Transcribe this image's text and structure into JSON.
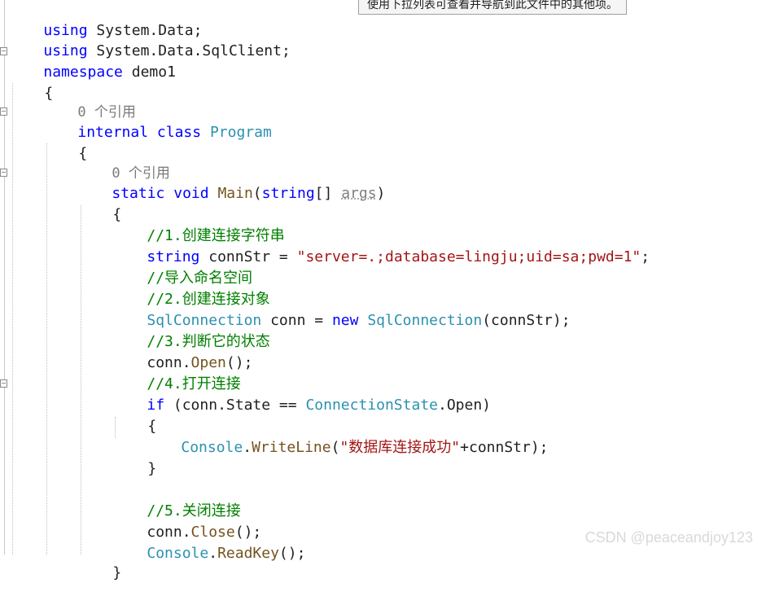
{
  "tooltip": {
    "text": "使用下拉列表可查看并导航到此文件中的其他项。"
  },
  "code": {
    "l1_kw": "using",
    "l1_rest": " System.Data;",
    "l2_kw": "using",
    "l2_rest": " System.Data.SqlClient;",
    "l3_kw": "namespace",
    "l3_rest": " demo1",
    "l4": "{",
    "l5_codelens": "0 个引用",
    "l6_kw1": "internal",
    "l6_kw2": "class",
    "l6_type": "Program",
    "l7": "{",
    "l8_codelens": "0 个引用",
    "l9_kw1": "static",
    "l9_kw2": "void",
    "l9_meth": "Main",
    "l9_open": "(",
    "l9_kw3": "string",
    "l9_brk": "[] ",
    "l9_param": "args",
    "l9_close": ")",
    "l10": "{",
    "l11_cmt": "//1.创建连接字符串",
    "l12_kw": "string",
    "l12_mid": " connStr = ",
    "l12_str": "\"server=.;database=lingju;uid=sa;pwd=1\"",
    "l12_end": ";",
    "l13_cmt": "//导入命名空间",
    "l14_cmt": "//2.创建连接对象",
    "l15_type1": "SqlConnection",
    "l15_mid": " conn = ",
    "l15_kw": "new",
    "l15_type2": "SqlConnection",
    "l15_end": "(connStr);",
    "l16_cmt": "//3.判断它的状态",
    "l17_obj": "conn.",
    "l17_meth": "Open",
    "l17_end": "();",
    "l18_cmt": "//4.打开连接",
    "l19_kw": "if",
    "l19_mid": " (conn.State == ",
    "l19_type": "ConnectionState",
    "l19_end": ".Open)",
    "l20": "{",
    "l21_type": "Console",
    "l21_dot": ".",
    "l21_meth": "WriteLine",
    "l21_open": "(",
    "l21_str": "\"数据库连接成功\"",
    "l21_end": "+connStr);",
    "l22": "}",
    "l23_cmt": "//5.关闭连接",
    "l24_obj": "conn.",
    "l24_meth": "Close",
    "l24_end": "();",
    "l25_type": "Console",
    "l25_dot": ".",
    "l25_meth": "ReadKey",
    "l25_end": "();",
    "l26": "}"
  },
  "fold_markers": {
    "namespace": "−",
    "class": "−",
    "main": "−",
    "if": "−"
  },
  "watermark": {
    "text": "CSDN @peaceandjoy123"
  },
  "colors": {
    "keyword": "#0000ff",
    "type": "#2b91af",
    "string": "#a31515",
    "comment": "#008000",
    "method": "#74531f",
    "codelens": "#7a7a7a"
  }
}
